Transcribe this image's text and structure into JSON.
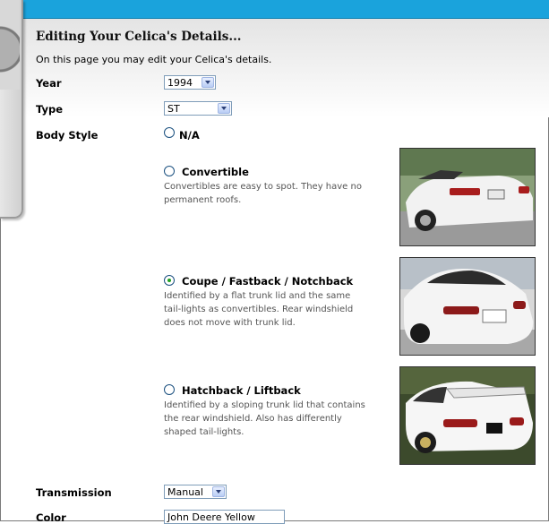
{
  "page": {
    "title": "Editing Your Celica's Details...",
    "intro": "On this page you may edit your Celica's details."
  },
  "fields": {
    "year": {
      "label": "Year",
      "value": "1994"
    },
    "type": {
      "label": "Type",
      "value": "ST"
    },
    "body_style": {
      "label": "Body Style",
      "na_label": "N/A"
    },
    "transmission": {
      "label": "Transmission",
      "value": "Manual"
    },
    "color": {
      "label": "Color",
      "value": "John Deere Yellow"
    }
  },
  "body_options": [
    {
      "title": "Convertible",
      "desc": [
        "Convertibles are easy to spot. They have no",
        "permanent roofs."
      ],
      "checked": false
    },
    {
      "title": "Coupe / Fastback / Notchback",
      "desc": [
        "Identified by a flat trunk lid and the same",
        "tail-lights as convertibles. Rear windshield",
        "does not move with trunk lid."
      ],
      "checked": true
    },
    {
      "title": "Hatchback / Liftback",
      "desc": [
        "Identified by a sloping trunk lid that contains",
        "the rear windshield. Also has differently",
        "shaped tail-lights."
      ],
      "checked": false
    }
  ],
  "colors": {
    "topbar": "#1aa3dc",
    "radio_checked": "#21a121"
  }
}
